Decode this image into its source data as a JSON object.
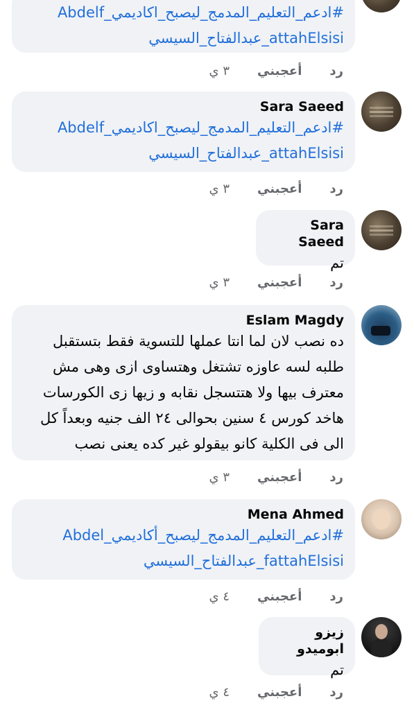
{
  "comments": [
    {
      "author": "",
      "lines": [
        "#ادعم_التعليم_المدمج_ليصبح_اكاديمي_Abdelf",
        "attahElsisi_عبدالفتاح_السيسي"
      ],
      "time": "٣ ي",
      "like": "أعجبني",
      "reply": "رد"
    },
    {
      "author": "Sara Saeed",
      "lines": [
        "#ادعم_التعليم_المدمج_ليصبح_اكاديمي_Abdelf",
        "attahElsisi_عبدالفتاح_السيسي"
      ],
      "time": "٣ ي",
      "like": "أعجبني",
      "reply": "رد"
    },
    {
      "author": "Sara Saeed",
      "text": "تم",
      "time": "٣ ي",
      "like": "أعجبني",
      "reply": "رد"
    },
    {
      "author": "Eslam Magdy",
      "text": "ده نصب لان لما انتا عملها للتسوية فقط بتستقبل\nطلبه لسه عاوزه تشتغل وهتساوى ازى وهى مش\nمعترف بيها ولا هتتسجل نقابه و زيها زى الكورسات\nهاخد كورس ٤ سنين بحوالى ٢٤ الف جنيه وبعداً كل\nالى فى الكلية كانو بيقولو غير كده يعنى نصب",
      "time": "٣ ي",
      "like": "أعجبني",
      "reply": "رد"
    },
    {
      "author": "Mena Ahmed",
      "lines": [
        "#ادعم_التعليم_المدمج_ليصبح_أكاديمي_Abdel",
        "fattahElsisi_عبدالفتاح_السيسي"
      ],
      "time": "٤ ي",
      "like": "أعجبني",
      "reply": "رد"
    },
    {
      "author": "زيزو ابوميدو",
      "text": "تم",
      "time": "٤ ي",
      "like": "أعجبني",
      "reply": "رد"
    }
  ]
}
